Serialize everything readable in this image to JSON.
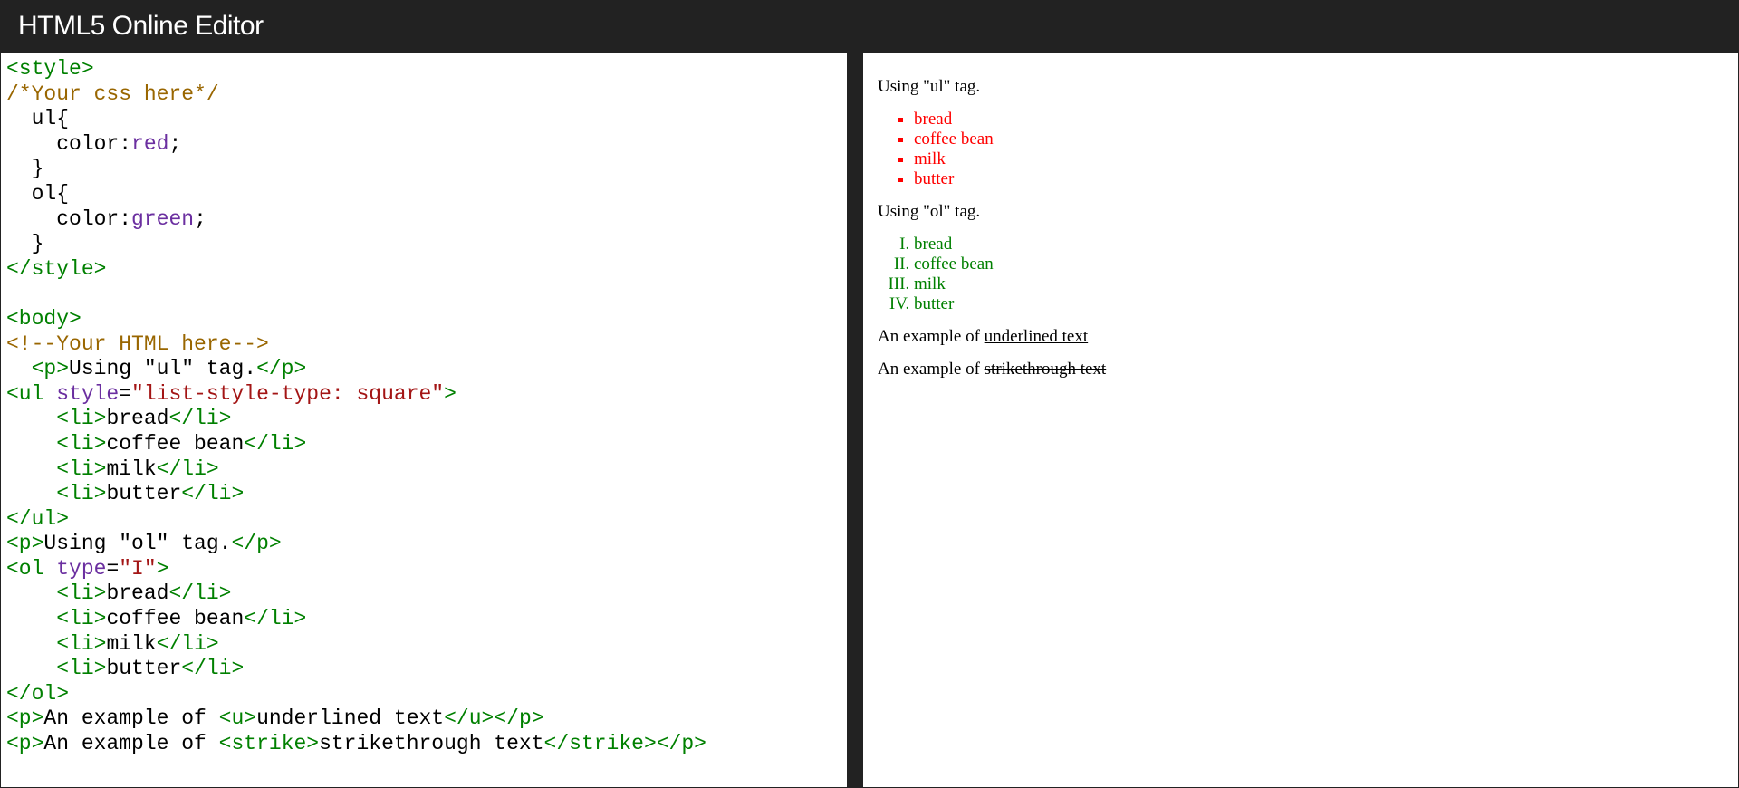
{
  "header": {
    "title": "HTML5 Online Editor"
  },
  "editor": {
    "code_lines": [
      [
        [
          "tag",
          "<style>"
        ]
      ],
      [
        [
          "comment",
          "/*Your css here*/"
        ]
      ],
      [
        [
          "plain",
          "  ul{"
        ]
      ],
      [
        [
          "plain",
          "    "
        ],
        [
          "cssprop",
          "color"
        ],
        [
          "plain",
          ":"
        ],
        [
          "cssval",
          "red"
        ],
        [
          "plain",
          ";"
        ]
      ],
      [
        [
          "plain",
          "  }"
        ]
      ],
      [
        [
          "plain",
          "  ol{"
        ]
      ],
      [
        [
          "plain",
          "    "
        ],
        [
          "cssprop",
          "color"
        ],
        [
          "plain",
          ":"
        ],
        [
          "cssval",
          "green"
        ],
        [
          "plain",
          ";"
        ]
      ],
      [
        [
          "plain",
          "  }"
        ],
        [
          "caret",
          ""
        ]
      ],
      [
        [
          "tag",
          "</style>"
        ]
      ],
      [
        [
          "plain",
          ""
        ]
      ],
      [
        [
          "tag",
          "<body>"
        ]
      ],
      [
        [
          "comment",
          "<!--Your HTML here-->"
        ]
      ],
      [
        [
          "plain",
          "  "
        ],
        [
          "tag",
          "<p>"
        ],
        [
          "plain",
          "Using \"ul\" tag."
        ],
        [
          "tag",
          "</p>"
        ]
      ],
      [
        [
          "tag",
          "<ul "
        ],
        [
          "attr",
          "style"
        ],
        [
          "plain",
          "="
        ],
        [
          "str",
          "\"list-style-type: square\""
        ],
        [
          "tag",
          ">"
        ]
      ],
      [
        [
          "plain",
          "    "
        ],
        [
          "tag",
          "<li>"
        ],
        [
          "plain",
          "bread"
        ],
        [
          "tag",
          "</li>"
        ]
      ],
      [
        [
          "plain",
          "    "
        ],
        [
          "tag",
          "<li>"
        ],
        [
          "plain",
          "coffee bean"
        ],
        [
          "tag",
          "</li>"
        ]
      ],
      [
        [
          "plain",
          "    "
        ],
        [
          "tag",
          "<li>"
        ],
        [
          "plain",
          "milk"
        ],
        [
          "tag",
          "</li>"
        ]
      ],
      [
        [
          "plain",
          "    "
        ],
        [
          "tag",
          "<li>"
        ],
        [
          "plain",
          "butter"
        ],
        [
          "tag",
          "</li>"
        ]
      ],
      [
        [
          "tag",
          "</ul>"
        ]
      ],
      [
        [
          "tag",
          "<p>"
        ],
        [
          "plain",
          "Using \"ol\" tag."
        ],
        [
          "tag",
          "</p>"
        ]
      ],
      [
        [
          "tag",
          "<ol "
        ],
        [
          "attr",
          "type"
        ],
        [
          "plain",
          "="
        ],
        [
          "str",
          "\"I\""
        ],
        [
          "tag",
          ">"
        ]
      ],
      [
        [
          "plain",
          "    "
        ],
        [
          "tag",
          "<li>"
        ],
        [
          "plain",
          "bread"
        ],
        [
          "tag",
          "</li>"
        ]
      ],
      [
        [
          "plain",
          "    "
        ],
        [
          "tag",
          "<li>"
        ],
        [
          "plain",
          "coffee bean"
        ],
        [
          "tag",
          "</li>"
        ]
      ],
      [
        [
          "plain",
          "    "
        ],
        [
          "tag",
          "<li>"
        ],
        [
          "plain",
          "milk"
        ],
        [
          "tag",
          "</li>"
        ]
      ],
      [
        [
          "plain",
          "    "
        ],
        [
          "tag",
          "<li>"
        ],
        [
          "plain",
          "butter"
        ],
        [
          "tag",
          "</li>"
        ]
      ],
      [
        [
          "tag",
          "</ol>"
        ]
      ],
      [
        [
          "tag",
          "<p>"
        ],
        [
          "plain",
          "An example of "
        ],
        [
          "tag",
          "<u>"
        ],
        [
          "plain",
          "underlined text"
        ],
        [
          "tag",
          "</u></p>"
        ]
      ],
      [
        [
          "tag",
          "<p>"
        ],
        [
          "plain",
          "An example of "
        ],
        [
          "tag",
          "<strike>"
        ],
        [
          "plain",
          "strikethrough text"
        ],
        [
          "tag",
          "</strike></p>"
        ]
      ]
    ]
  },
  "preview": {
    "p_ul": "Using \"ul\" tag.",
    "ul_items": [
      "bread",
      "coffee bean",
      "milk",
      "butter"
    ],
    "p_ol": "Using \"ol\" tag.",
    "ol_items": [
      "bread",
      "coffee bean",
      "milk",
      "butter"
    ],
    "p_u_pre": "An example of ",
    "p_u_text": "underlined text",
    "p_s_pre": "An example of ",
    "p_s_text": "strikethrough text"
  }
}
